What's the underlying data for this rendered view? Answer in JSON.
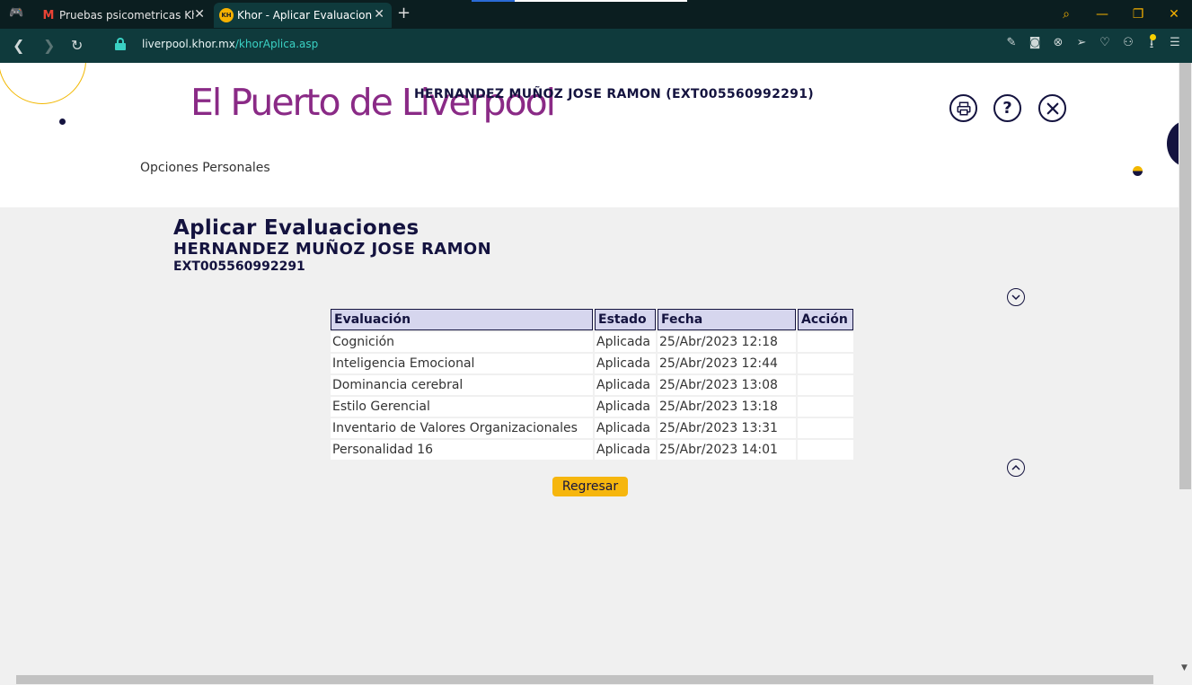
{
  "browser": {
    "tabs": [
      {
        "title": "Pruebas psicometricas Khor",
        "favicon": "gmail-icon",
        "active": false
      },
      {
        "title": "Khor - Aplicar Evaluaciones",
        "favicon": "khor-icon",
        "active": true
      }
    ],
    "url_host": "liverpool.khor.mx",
    "url_path": "/khorAplica.asp"
  },
  "header": {
    "logo_text": "El Puerto de Liverpool",
    "user_label": "HERNANDEZ MUÑOZ JOSE RAMON (EXT005560992291)",
    "help_glyph": "?",
    "menu_link": "Opciones Personales"
  },
  "main": {
    "title": "Aplicar Evaluaciones",
    "person_name": "HERNANDEZ MUÑOZ JOSE RAMON",
    "person_id": "EXT005560992291",
    "table": {
      "headers": [
        "Evaluación",
        "Estado",
        "Fecha",
        "Acción"
      ],
      "rows": [
        [
          "Cognición",
          "Aplicada",
          "25/Abr/2023 12:18",
          ""
        ],
        [
          "Inteligencia Emocional",
          "Aplicada",
          "25/Abr/2023 12:44",
          ""
        ],
        [
          "Dominancia cerebral",
          "Aplicada",
          "25/Abr/2023 13:08",
          ""
        ],
        [
          "Estilo Gerencial",
          "Aplicada",
          "25/Abr/2023 13:18",
          ""
        ],
        [
          "Inventario de Valores Organizacionales",
          "Aplicada",
          "25/Abr/2023 13:31",
          ""
        ],
        [
          "Personalidad 16",
          "Aplicada",
          "25/Abr/2023 14:01",
          ""
        ]
      ]
    },
    "back_button": "Regresar"
  },
  "colors": {
    "brand_purple": "#8a2a86",
    "navy": "#14133f",
    "accent_yellow": "#f6b60e",
    "header_cell_bg": "#d6d6ee",
    "browser_dark": "#0b1e20",
    "browser_teal": "#0f3a3c"
  }
}
